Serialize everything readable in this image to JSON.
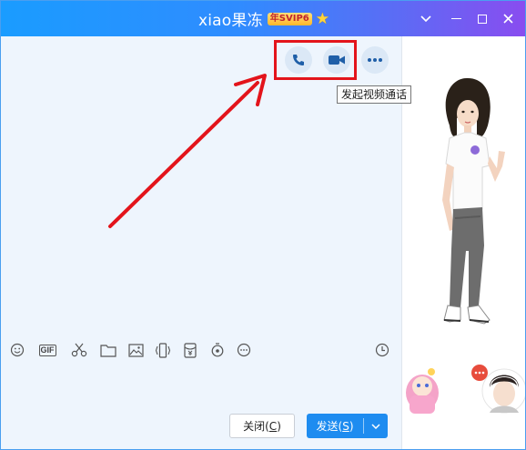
{
  "title": {
    "name": "xiao果冻",
    "vip_badge": "年SVIP6",
    "star_icon": "star-icon"
  },
  "window_controls": [
    "chevron-down-icon",
    "minimize-icon",
    "maximize-icon",
    "close-icon"
  ],
  "call_buttons": {
    "voice_icon": "phone-icon",
    "video_icon": "video-camera-icon",
    "more_icon": "more-icon"
  },
  "tooltip": "发起视频通话",
  "toolbar": {
    "icons": [
      "emoji-icon",
      "gif-icon",
      "scissors-icon",
      "folder-icon",
      "image-icon",
      "shake-icon",
      "red-packet-icon",
      "music-icon",
      "more-icon",
      "history-clock-icon"
    ],
    "gif_text": "GIF"
  },
  "buttons": {
    "close_label": "关闭(",
    "close_key": "C",
    "close_end": ")",
    "send_label": "发送(",
    "send_key": "S",
    "send_end": ")"
  },
  "colors": {
    "title_gradient_start": "#1a9cff",
    "title_gradient_end": "#8a4cf0",
    "annotation_red": "#e3141b",
    "send_blue": "#1e8cf0",
    "chat_bg": "#eef5fd"
  }
}
